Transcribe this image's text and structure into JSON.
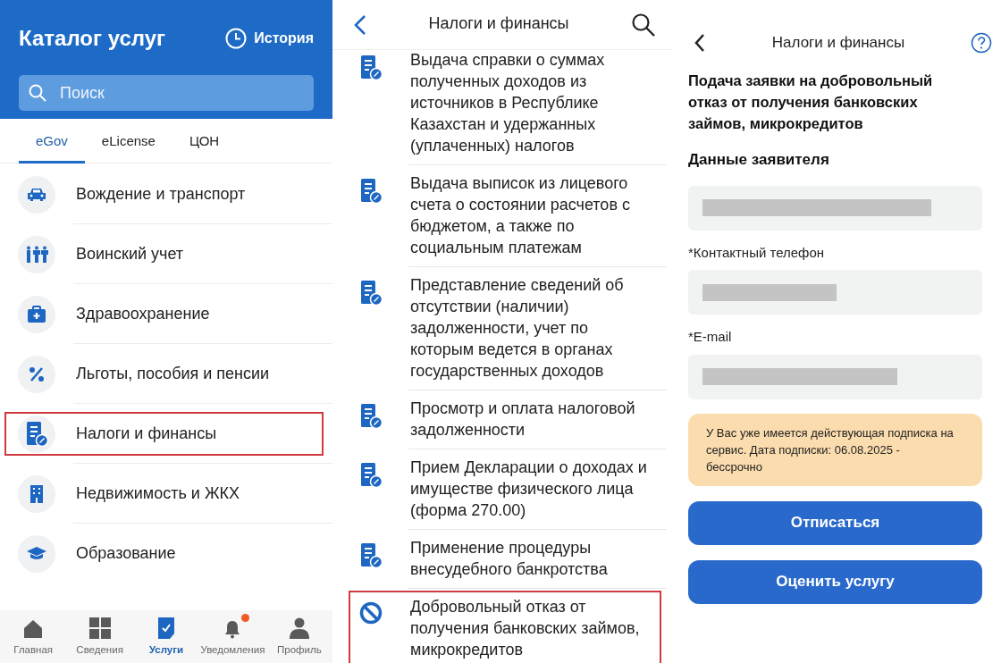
{
  "catalog": {
    "title": "Каталог услуг",
    "history": "История",
    "search": {
      "placeholder": "Поиск"
    },
    "tabs": [
      {
        "label": "eGov",
        "selected": true
      },
      {
        "label": "eLicense",
        "selected": false
      },
      {
        "label": "ЦОН",
        "selected": false
      }
    ],
    "items": [
      {
        "label": "Вождение и транспорт",
        "highlighted": false
      },
      {
        "label": "Воинский учет",
        "highlighted": false
      },
      {
        "label": "Здравоохранение",
        "highlighted": false
      },
      {
        "label": "Льготы, пособия и пенсии",
        "highlighted": false
      },
      {
        "label": "Налоги и финансы",
        "highlighted": true
      },
      {
        "label": "Недвижимость и ЖКХ",
        "highlighted": false
      },
      {
        "label": "Образование",
        "highlighted": false
      }
    ],
    "nav": [
      {
        "label": "Главная",
        "selected": false,
        "dot": false
      },
      {
        "label": "Сведения",
        "selected": false,
        "dot": false
      },
      {
        "label": "Услуги",
        "selected": true,
        "dot": false
      },
      {
        "label": "Уведомления",
        "selected": false,
        "dot": true
      },
      {
        "label": "Профиль",
        "selected": false,
        "dot": false
      }
    ]
  },
  "services": {
    "title": "Налоги и финансы",
    "items": [
      {
        "label": "Выдача справки о суммах полученных доходов из источников в Республике Казахстан и удержанных (уплаченных) налогов",
        "highlighted": false
      },
      {
        "label": "Выдача выписок из лицевого счета о состоянии расчетов с бюджетом, а также по социальным платежам",
        "highlighted": false
      },
      {
        "label": "Представление сведений об отсутствии (наличии) задолженности, учет по которым ведется в органах государственных доходов",
        "highlighted": false
      },
      {
        "label": "Просмотр и оплата налоговой задолженности",
        "highlighted": false
      },
      {
        "label": "Прием Декларации о доходах и имуществе физического лица (форма 270.00)",
        "highlighted": false
      },
      {
        "label": "Применение процедуры внесудебного банкротства",
        "highlighted": false
      },
      {
        "label": "Добровольный отказ от получения банковских займов, микрокредитов",
        "highlighted": true
      }
    ]
  },
  "form": {
    "title": "Налоги и финансы",
    "heading": "Подача заявки на добровольный отказ от получения банковских займов, микрокредитов",
    "section": "Данные заявителя",
    "fields": [
      {
        "redacted": true
      },
      {
        "label": "*Контактный телефон",
        "redacted": true
      },
      {
        "label": "*E-mail",
        "redacted": true
      }
    ],
    "notice": "У Вас уже имеется действующая подписка на сервис. Дата подписки: 06.08.2025 - бессрочно",
    "buttons": [
      "Отписаться",
      "Оценить услугу"
    ]
  }
}
